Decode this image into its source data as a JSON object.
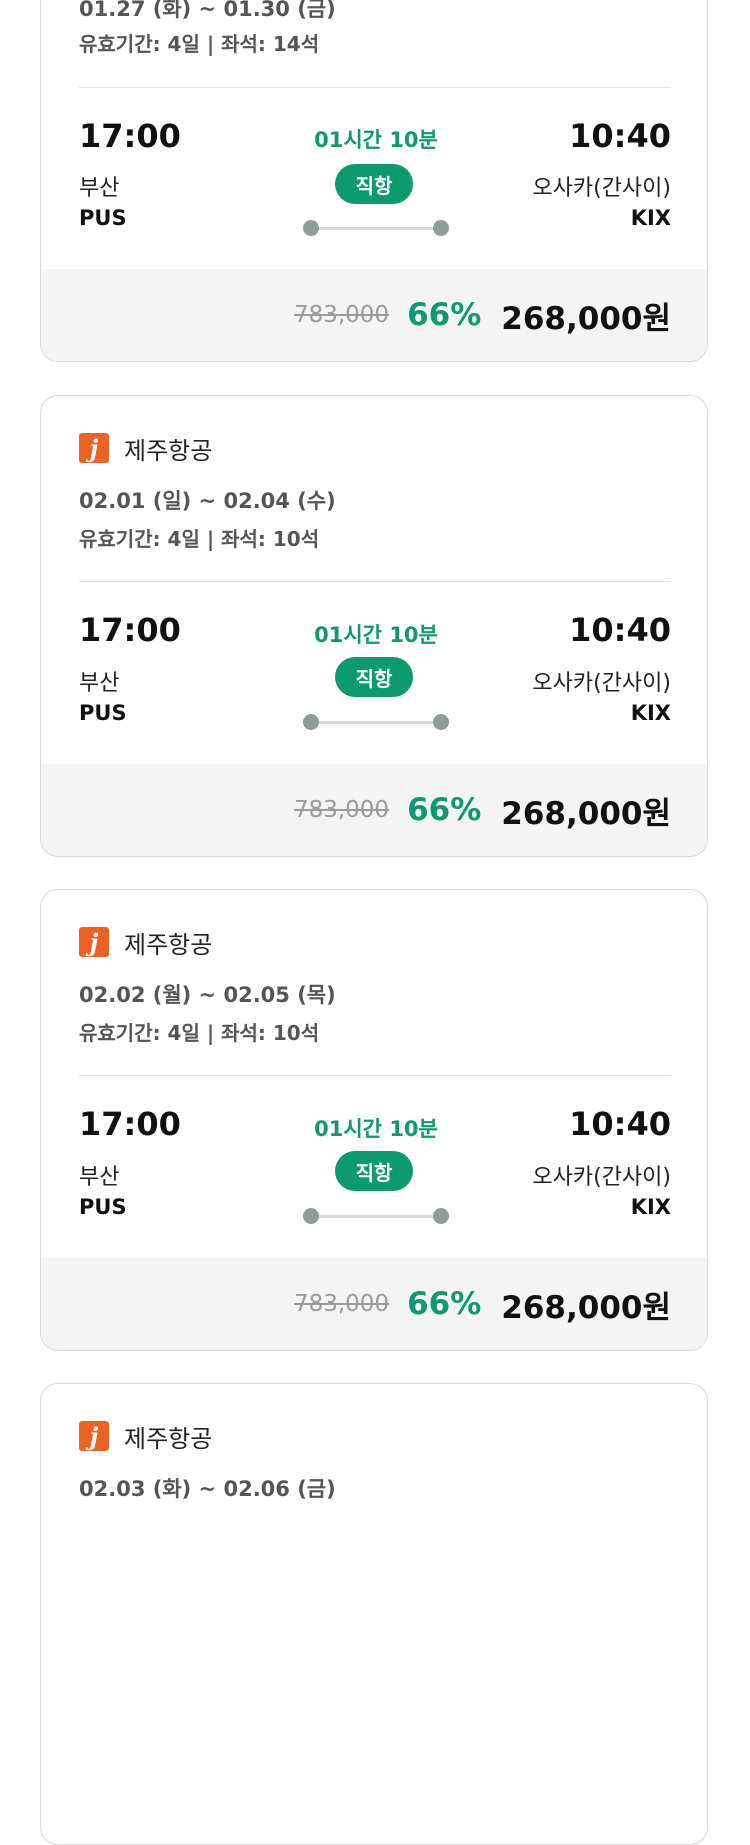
{
  "flights": [
    {
      "airline": "",
      "dates": "01.27 (화) ~ 01.30 (금)",
      "validity": "유효기간: 4일 | 좌석: 14석",
      "departure": {
        "time": "17:00",
        "city": "부산",
        "code": "PUS"
      },
      "arrival": {
        "time": "10:40",
        "city": "오사카(간사이)",
        "code": "KIX"
      },
      "duration": "01시간 10분",
      "direct": "직항",
      "original_price": "783,000",
      "discount": "66%",
      "price": "268,000원"
    },
    {
      "airline": "제주항공",
      "logo_letter": "j",
      "dates": "02.01 (일) ~ 02.04 (수)",
      "validity": "유효기간: 4일 | 좌석: 10석",
      "departure": {
        "time": "17:00",
        "city": "부산",
        "code": "PUS"
      },
      "arrival": {
        "time": "10:40",
        "city": "오사카(간사이)",
        "code": "KIX"
      },
      "duration": "01시간 10분",
      "direct": "직항",
      "original_price": "783,000",
      "discount": "66%",
      "price": "268,000원"
    },
    {
      "airline": "제주항공",
      "logo_letter": "j",
      "dates": "02.02 (월) ~ 02.05 (목)",
      "validity": "유효기간: 4일 | 좌석: 10석",
      "departure": {
        "time": "17:00",
        "city": "부산",
        "code": "PUS"
      },
      "arrival": {
        "time": "10:40",
        "city": "오사카(간사이)",
        "code": "KIX"
      },
      "duration": "01시간 10분",
      "direct": "직항",
      "original_price": "783,000",
      "discount": "66%",
      "price": "268,000원"
    },
    {
      "airline": "제주항공",
      "logo_letter": "j",
      "dates": "02.03 (화) ~ 02.06 (금)"
    }
  ],
  "colors": {
    "accent_green": "#109870",
    "badge_green": "#0d9a6f",
    "logo_orange": "#ec6224",
    "price_strike_gray": "#9b9b9b"
  },
  "icons": {
    "airline_logo": "jeju-air-logo-icon"
  }
}
